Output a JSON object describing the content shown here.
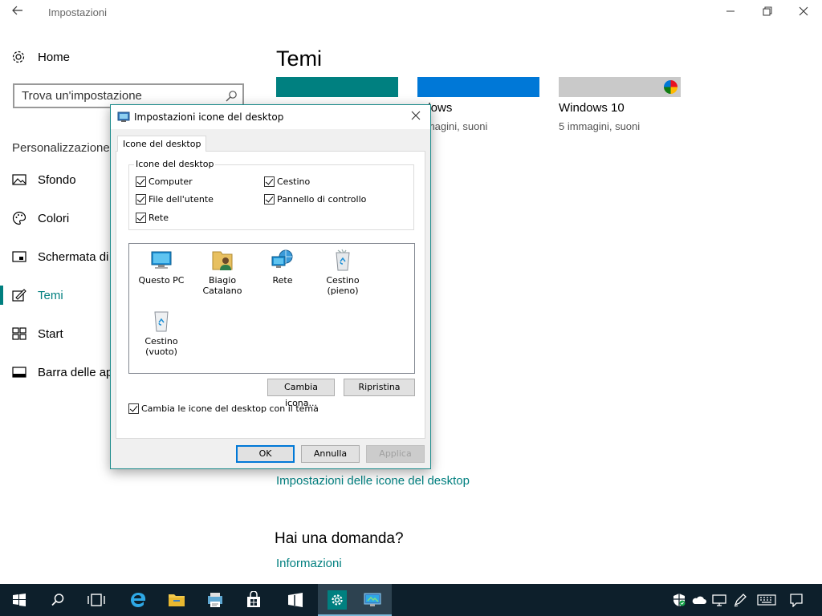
{
  "window": {
    "title": "Impostazioni",
    "back_icon": "back-arrow-icon",
    "minimize_icon": "minimize-icon",
    "restore_icon": "restore-icon",
    "close_icon": "close-icon"
  },
  "sidebar": {
    "home_label": "Home",
    "search_placeholder": "Trova un'impostazione",
    "section_label": "Personalizzazione",
    "items": [
      {
        "label": "Sfondo",
        "icon": "picture-icon",
        "active": false
      },
      {
        "label": "Colori",
        "icon": "palette-icon",
        "active": false
      },
      {
        "label": "Schermata di",
        "icon": "lock-screen-icon",
        "active": false
      },
      {
        "label": "Temi",
        "icon": "brush-icon",
        "active": true
      },
      {
        "label": "Start",
        "icon": "start-tiles-icon",
        "active": false
      },
      {
        "label": "Barra delle ap",
        "icon": "taskbar-icon",
        "active": false
      }
    ]
  },
  "main": {
    "title": "Temi",
    "themes": [
      {
        "name": "",
        "subtitle": "",
        "color": "#008080"
      },
      {
        "name": "ndows",
        "subtitle": "mmagini, suoni",
        "color": "#0078d7"
      },
      {
        "name": "Windows 10",
        "subtitle": "5 immagini, suoni",
        "color": "#c9c9c9"
      }
    ],
    "desktop_icons_link": "Impostazioni delle icone del desktop",
    "question_heading": "Hai una domanda?",
    "info_link": "Informazioni"
  },
  "dialog": {
    "title": "Impostazioni icone del desktop",
    "tab_label": "Icone del desktop",
    "group_label": "Icone del desktop",
    "checkboxes": [
      {
        "label": "Computer",
        "checked": true
      },
      {
        "label": "Cestino",
        "checked": true
      },
      {
        "label": "File dell'utente",
        "checked": true
      },
      {
        "label": "Pannello di controllo",
        "checked": true
      },
      {
        "label": "Rete",
        "checked": true
      }
    ],
    "icons": [
      {
        "label": "Questo PC",
        "icon": "computer-icon"
      },
      {
        "label": "Biagio Catalano",
        "icon": "user-folder-icon"
      },
      {
        "label": "Rete",
        "icon": "network-icon"
      },
      {
        "label": "Cestino (pieno)",
        "icon": "recycle-bin-full-icon"
      },
      {
        "label": "Cestino (vuoto)",
        "icon": "recycle-bin-empty-icon"
      }
    ],
    "change_icon_button": "Cambia icona...",
    "restore_button": "Ripristina",
    "allow_themes_checkbox": "Cambia le icone del desktop con il tema",
    "ok_button": "OK",
    "cancel_button": "Annulla",
    "apply_button": "Applica"
  },
  "taskbar": {
    "buttons": [
      "start-icon",
      "search-icon",
      "task-view-icon",
      "edge-icon",
      "file-explorer-icon",
      "printer-app-icon",
      "store-icon",
      "media-app-icon",
      "settings-icon",
      "desktop-icons-app-icon"
    ],
    "tray": [
      "defender-icon",
      "onedrive-icon",
      "projector-icon",
      "pen-icon",
      "keyboard-icon",
      "notification-icon"
    ]
  }
}
